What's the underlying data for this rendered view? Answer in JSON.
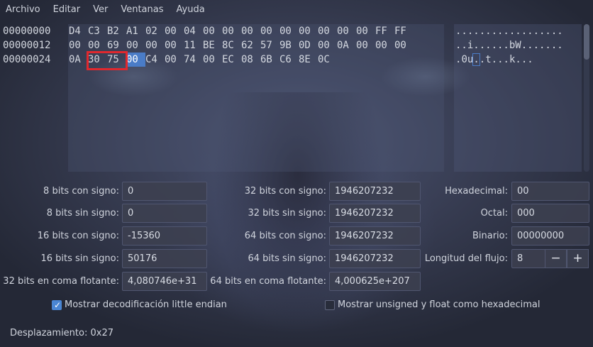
{
  "menu": [
    "Archivo",
    "Editar",
    "Ver",
    "Ventanas",
    "Ayuda"
  ],
  "hex_view": {
    "rows": [
      {
        "address": "00000000",
        "bytes": [
          "D4",
          "C3",
          "B2",
          "A1",
          "02",
          "00",
          "04",
          "00",
          "00",
          "00",
          "00",
          "00",
          "00",
          "00",
          "00",
          "00",
          "FF",
          "FF"
        ],
        "ascii": ".................."
      },
      {
        "address": "00000012",
        "bytes": [
          "00",
          "00",
          "69",
          "00",
          "00",
          "00",
          "11",
          "BE",
          "8C",
          "62",
          "57",
          "9B",
          "0D",
          "00",
          "0A",
          "00",
          "00",
          "00"
        ],
        "ascii": "..i......bW......."
      },
      {
        "address": "00000024",
        "bytes": [
          "0A",
          "30",
          "75",
          "00",
          "C4",
          "00",
          "74",
          "00",
          "EC",
          "08",
          "6B",
          "C6",
          "8E",
          "0C"
        ],
        "ascii": ".0u..t...k..."
      }
    ],
    "selected_byte": "00"
  },
  "inspector": {
    "int8": {
      "label": "8 bits con signo:",
      "value": "0"
    },
    "uint8": {
      "label": "8 bits sin signo:",
      "value": "0"
    },
    "int16": {
      "label": "16 bits con signo:",
      "value": "-15360"
    },
    "uint16": {
      "label": "16 bits sin signo:",
      "value": "50176"
    },
    "float32": {
      "label": "32 bits en coma flotante:",
      "value": "4,080746e+31"
    },
    "int32": {
      "label": "32 bits con signo:",
      "value": "1946207232"
    },
    "uint32": {
      "label": "32 bits sin signo:",
      "value": "1946207232"
    },
    "int64": {
      "label": "64 bits con signo:",
      "value": "1946207232"
    },
    "uint64": {
      "label": "64 bits sin signo:",
      "value": "1946207232"
    },
    "float64": {
      "label": "64 bits en coma flotante:",
      "value": "4,000625e+207"
    },
    "hex": {
      "label": "Hexadecimal:",
      "value": "00"
    },
    "octal": {
      "label": "Octal:",
      "value": "000"
    },
    "binary": {
      "label": "Binario:",
      "value": "00000000"
    },
    "stream_length": {
      "label": "Longitud del flujo:",
      "value": "8",
      "minus": "−",
      "plus": "+"
    }
  },
  "options": {
    "little_endian": {
      "label": "Mostrar decodificación little endian",
      "checked": true
    },
    "unsigned_hex": {
      "label": "Mostrar unsigned y float como hexadecimal",
      "checked": false
    }
  },
  "status": {
    "offset": "Desplazamiento: 0x27"
  },
  "colors": {
    "selection": "#4a7cc7",
    "highlight_box": "#e0282e"
  }
}
